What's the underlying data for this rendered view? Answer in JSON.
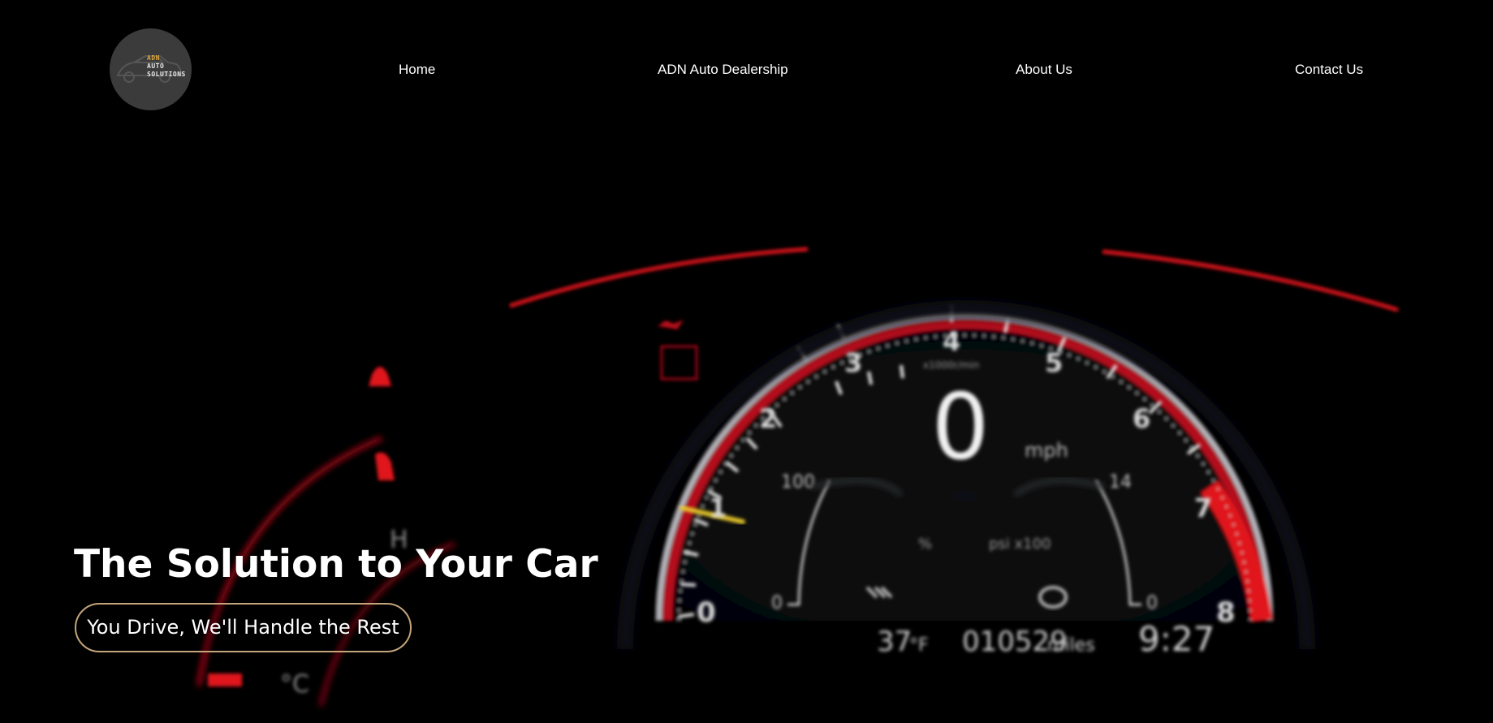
{
  "logo": {
    "line1": "ADN",
    "line2": "AUTO",
    "line3": "SOLUTIONS",
    "icon": "car-icon"
  },
  "nav": {
    "items": [
      {
        "label": "Home"
      },
      {
        "label": "ADN Auto Dealership"
      },
      {
        "label": "About Us"
      },
      {
        "label": "Contact Us"
      }
    ]
  },
  "hero": {
    "title": "The Solution to Your Car",
    "cta_label": "You Drive, We'll Handle the Rest",
    "background": {
      "tach_labels": [
        "0",
        "1",
        "2",
        "3",
        "4",
        "5",
        "6",
        "7",
        "8"
      ],
      "rpm_unit": "x1000r/min",
      "speed_value": "0",
      "speed_unit": "mph",
      "left_gauge_top": "100",
      "left_gauge_bottom": "0",
      "left_gauge_unit": "%",
      "right_gauge_top": "14",
      "right_gauge_bottom": "0",
      "right_gauge_unit": "psi x100",
      "temperature": "37",
      "temperature_unit": "°F",
      "odometer": "010529",
      "odometer_unit": "miles",
      "clock": "9:27",
      "temp_gauge_high": "H",
      "temp_gauge_unit": "°C"
    }
  },
  "colors": {
    "background": "#000000",
    "gauge_red": "#e0141a",
    "pill_border": "#c4a57c",
    "text": "#ffffff",
    "logo_bg": "#3b3b3b",
    "logo_accent": "#d9a441"
  }
}
